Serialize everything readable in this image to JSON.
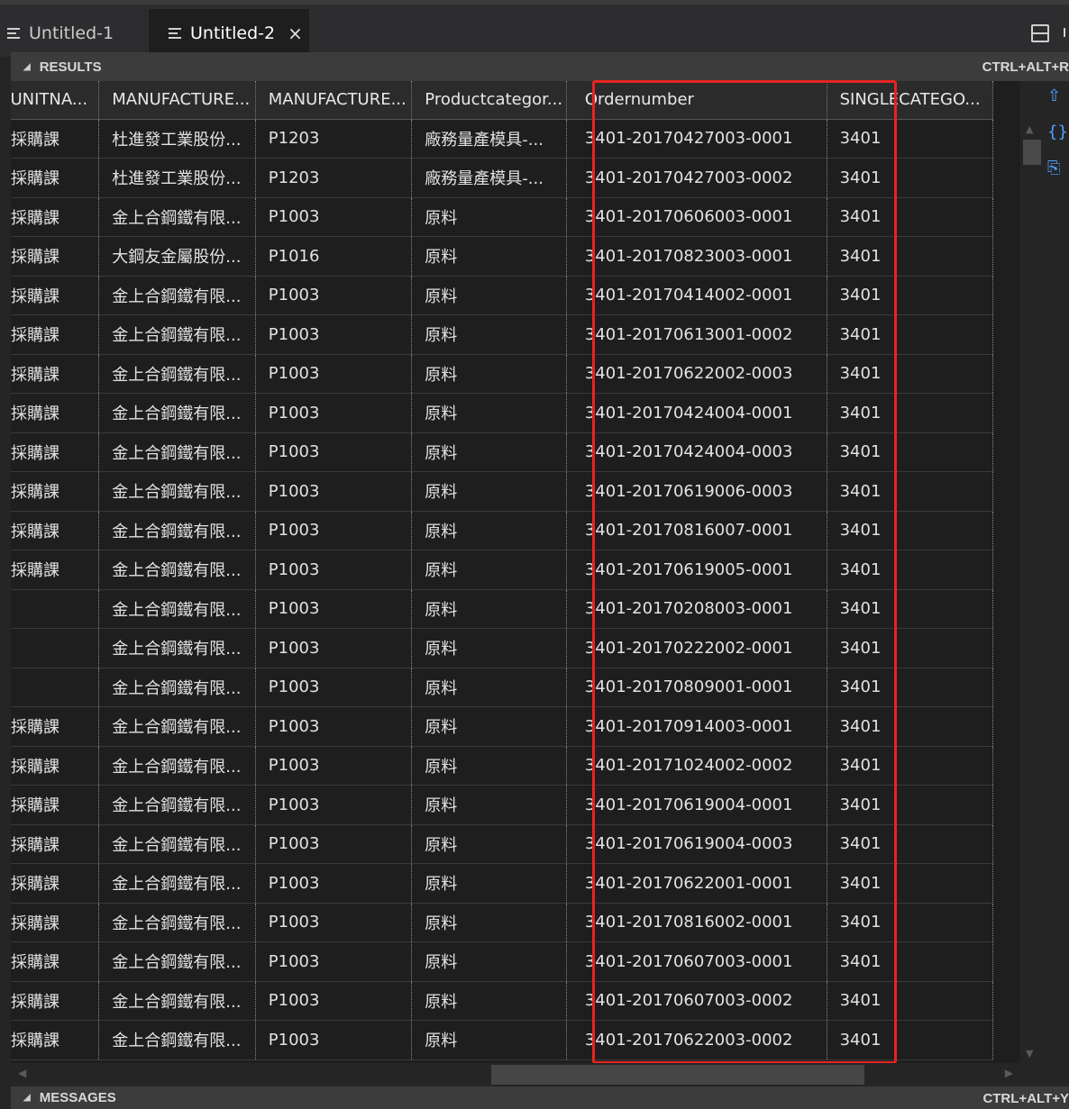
{
  "tabs": [
    {
      "label": "Untitled-1"
    },
    {
      "label": "Untitled-2",
      "close": "×"
    }
  ],
  "results": {
    "label": "RESULTS",
    "shortcut": "CTRL+ALT+R"
  },
  "messages": {
    "label": "MESSAGES",
    "shortcut": "CTRL+ALT+Y"
  },
  "columns": [
    "NUNITNA...",
    "MANUFACTURE...",
    "MANUFACTURE...",
    "Productcategor...",
    "Ordernumber",
    "SINGLECATEGO..."
  ],
  "rows": [
    [
      "採購課",
      "杜進發工業股份...",
      "P1203",
      "廠務量產模具-...",
      "3401-20170427003-0001",
      "3401"
    ],
    [
      "採購課",
      "杜進發工業股份...",
      "P1203",
      "廠務量產模具-...",
      "3401-20170427003-0002",
      "3401"
    ],
    [
      "採購課",
      "金上合鋼鐵有限...",
      "P1003",
      "原料",
      "3401-20170606003-0001",
      "3401"
    ],
    [
      "採購課",
      "大鋼友金屬股份...",
      "P1016",
      "原料",
      "3401-20170823003-0001",
      "3401"
    ],
    [
      "採購課",
      "金上合鋼鐵有限...",
      "P1003",
      "原料",
      "3401-20170414002-0001",
      "3401"
    ],
    [
      "採購課",
      "金上合鋼鐵有限...",
      "P1003",
      "原料",
      "3401-20170613001-0002",
      "3401"
    ],
    [
      "採購課",
      "金上合鋼鐵有限...",
      "P1003",
      "原料",
      "3401-20170622002-0003",
      "3401"
    ],
    [
      "採購課",
      "金上合鋼鐵有限...",
      "P1003",
      "原料",
      "3401-20170424004-0001",
      "3401"
    ],
    [
      "採購課",
      "金上合鋼鐵有限...",
      "P1003",
      "原料",
      "3401-20170424004-0003",
      "3401"
    ],
    [
      "採購課",
      "金上合鋼鐵有限...",
      "P1003",
      "原料",
      "3401-20170619006-0003",
      "3401"
    ],
    [
      "採購課",
      "金上合鋼鐵有限...",
      "P1003",
      "原料",
      "3401-20170816007-0001",
      "3401"
    ],
    [
      "採購課",
      "金上合鋼鐵有限...",
      "P1003",
      "原料",
      "3401-20170619005-0001",
      "3401"
    ],
    [
      "",
      "金上合鋼鐵有限...",
      "P1003",
      "原料",
      "3401-20170208003-0001",
      "3401"
    ],
    [
      "",
      "金上合鋼鐵有限...",
      "P1003",
      "原料",
      "3401-20170222002-0001",
      "3401"
    ],
    [
      "",
      "金上合鋼鐵有限...",
      "P1003",
      "原料",
      "3401-20170809001-0001",
      "3401"
    ],
    [
      "採購課",
      "金上合鋼鐵有限...",
      "P1003",
      "原料",
      "3401-20170914003-0001",
      "3401"
    ],
    [
      "採購課",
      "金上合鋼鐵有限...",
      "P1003",
      "原料",
      "3401-20171024002-0002",
      "3401"
    ],
    [
      "採購課",
      "金上合鋼鐵有限...",
      "P1003",
      "原料",
      "3401-20170619004-0001",
      "3401"
    ],
    [
      "採購課",
      "金上合鋼鐵有限...",
      "P1003",
      "原料",
      "3401-20170619004-0003",
      "3401"
    ],
    [
      "採購課",
      "金上合鋼鐵有限...",
      "P1003",
      "原料",
      "3401-20170622001-0001",
      "3401"
    ],
    [
      "採購課",
      "金上合鋼鐵有限...",
      "P1003",
      "原料",
      "3401-20170816002-0001",
      "3401"
    ],
    [
      "採購課",
      "金上合鋼鐵有限...",
      "P1003",
      "原料",
      "3401-20170607003-0001",
      "3401"
    ],
    [
      "採購課",
      "金上合鋼鐵有限...",
      "P1003",
      "原料",
      "3401-20170607003-0002",
      "3401"
    ],
    [
      "採購課",
      "金上合鋼鐵有限...",
      "P1003",
      "原料",
      "3401-20170622003-0002",
      "3401"
    ]
  ],
  "highlight_color": "#e8231f",
  "icons": [
    "document-lines-icon",
    "close-icon",
    "split-layout-icon",
    "collapse-triangle-icon",
    "export-icon",
    "json-icon",
    "copy-icon"
  ]
}
